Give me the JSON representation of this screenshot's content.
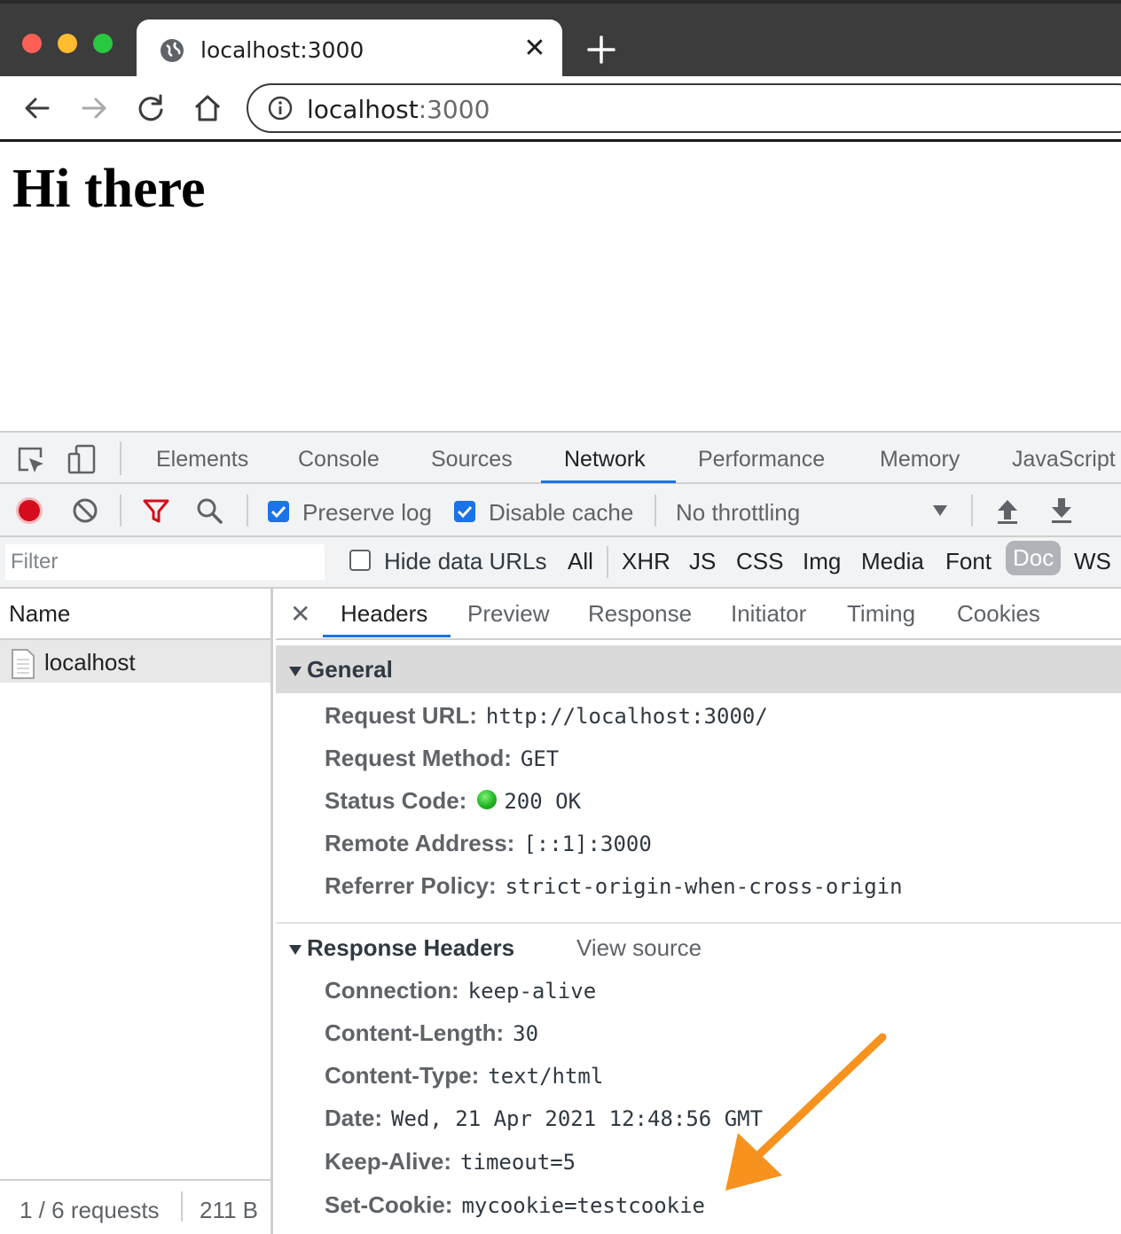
{
  "browser": {
    "tab_title": "localhost:3000",
    "address_host": "localhost",
    "address_port": ":3000"
  },
  "page": {
    "heading": "Hi there"
  },
  "devtools": {
    "tabs": [
      "Elements",
      "Console",
      "Sources",
      "Network",
      "Performance",
      "Memory",
      "JavaScript"
    ],
    "active_tab": "Network",
    "network_toolbar": {
      "preserve_log": {
        "label": "Preserve log",
        "checked": true
      },
      "disable_cache": {
        "label": "Disable cache",
        "checked": true
      },
      "throttling": "No throttling"
    },
    "filter": {
      "placeholder": "Filter",
      "hide_data_urls": "Hide data URLs",
      "types": [
        "All",
        "XHR",
        "JS",
        "CSS",
        "Img",
        "Media",
        "Font",
        "Doc",
        "WS"
      ],
      "selected_type": "Doc"
    },
    "requests": {
      "column_name": "Name",
      "items": [
        "localhost"
      ],
      "summary_count": "1 / 6 requests",
      "summary_size": "211 B"
    },
    "details": {
      "tabs": [
        "Headers",
        "Preview",
        "Response",
        "Initiator",
        "Timing",
        "Cookies"
      ],
      "active_tab": "Headers",
      "general": {
        "title": "General",
        "rows": [
          {
            "key": "Request URL:",
            "value": "http://localhost:3000/"
          },
          {
            "key": "Request Method:",
            "value": "GET"
          },
          {
            "key": "Status Code:",
            "value": "200 OK"
          },
          {
            "key": "Remote Address:",
            "value": "[::1]:3000"
          },
          {
            "key": "Referrer Policy:",
            "value": "strict-origin-when-cross-origin"
          }
        ]
      },
      "response_headers": {
        "title": "Response Headers",
        "view_source": "View source",
        "rows": [
          {
            "key": "Connection:",
            "value": "keep-alive"
          },
          {
            "key": "Content-Length:",
            "value": "30"
          },
          {
            "key": "Content-Type:",
            "value": "text/html"
          },
          {
            "key": "Date:",
            "value": "Wed, 21 Apr 2021 12:48:56 GMT"
          },
          {
            "key": "Keep-Alive:",
            "value": "timeout=5"
          },
          {
            "key": "Set-Cookie:",
            "value": "mycookie=testcookie"
          }
        ]
      }
    }
  },
  "colors": {
    "accent": "#1a73e8",
    "record": "#d50c1c",
    "status_ok": "#22b422",
    "annotation_arrow": "#f7921e"
  }
}
